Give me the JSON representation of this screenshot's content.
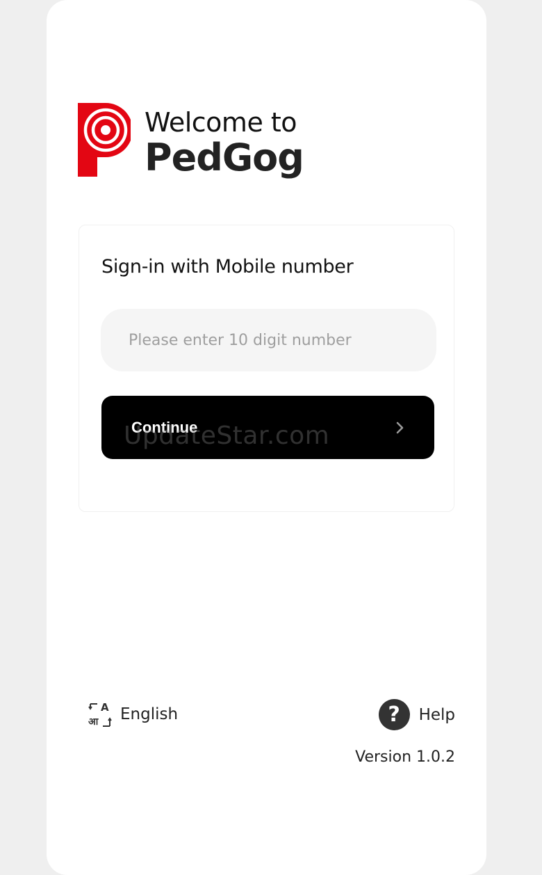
{
  "header": {
    "welcome_text": "Welcome to",
    "app_name": "PedGog",
    "logo_icon": "pedgog-logo-icon",
    "brand_color": "#e30613"
  },
  "signin": {
    "title": "Sign-in with Mobile number",
    "phone_input": {
      "value": "",
      "placeholder": "Please enter 10 digit number"
    },
    "continue_label": "Continue",
    "continue_icon": "chevron-right-icon"
  },
  "watermark": "UpdateStar.com",
  "footer": {
    "language_icon": "language-translate-icon",
    "language_label": "English",
    "help_icon": "help-circle-icon",
    "help_label": "Help",
    "version_text": "Version  1.0.2"
  }
}
